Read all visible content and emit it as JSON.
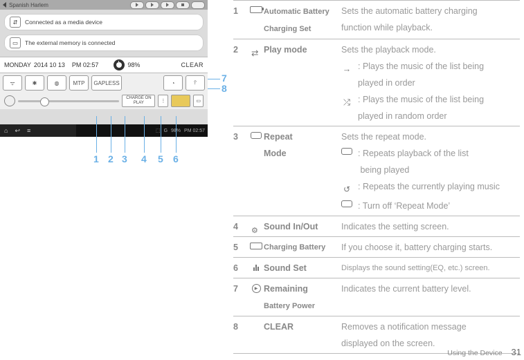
{
  "device": {
    "statusbar_title": "Spanish Harlem",
    "notice1": "Connected as a media device",
    "notice2": "The external memory is connected",
    "day": "MONDAY",
    "date": "2014 10 13",
    "time": "PM 02:57",
    "battery_pct": "98%",
    "clear": "CLEAR",
    "mtp": "MTP",
    "gapless": "GAPLESS",
    "charge": "CHARGE ON PLAY",
    "bottom_time": "PM 02:57",
    "bottom_pct": "98%"
  },
  "callouts": {
    "n1": "1",
    "n2": "2",
    "n3": "3",
    "n4": "4",
    "n5": "5",
    "n6": "6",
    "n7": "7",
    "n8": "8"
  },
  "table": {
    "r1": {
      "num": "1",
      "label_l1": "Automatic Battery",
      "label_l2": "Charging Set",
      "desc_l1": "Sets the automatic battery charging",
      "desc_l2": "function while playback."
    },
    "r2": {
      "num": "2",
      "label": "Play mode",
      "desc": "Sets the playback mode.",
      "sub1_l1": ": Plays the music of the list being",
      "sub1_l2": "played in order",
      "sub2_l1": ": Plays the music of the list being",
      "sub2_l2": "played in random order"
    },
    "r3": {
      "num": "3",
      "label_l1": "Repeat",
      "label_l2": "Mode",
      "desc": "Sets the repeat mode.",
      "sub1_l1": ": Repeats playback of the list",
      "sub1_l2": "being played",
      "sub2": ": Repeats the currently playing music",
      "sub3": ": Turn off ‘Repeat Mode’"
    },
    "r4": {
      "num": "4",
      "label": "Sound In/Out",
      "desc": "Indicates the setting screen."
    },
    "r5": {
      "num": "5",
      "label": "Charging Battery",
      "desc": "If you choose it, battery charging starts."
    },
    "r6": {
      "num": "6",
      "label": "Sound Set",
      "desc": "Displays the sound setting(EQ, etc.) screen."
    },
    "r7": {
      "num": "7",
      "label_l1": "Remaining",
      "label_l2": "Battery Power",
      "desc": "Indicates the current battery level."
    },
    "r8": {
      "num": "8",
      "label": "CLEAR",
      "desc_l1": "Removes a notification message",
      "desc_l2": "displayed on the screen."
    }
  },
  "footer": {
    "section": "Using the Device",
    "page": "31"
  }
}
